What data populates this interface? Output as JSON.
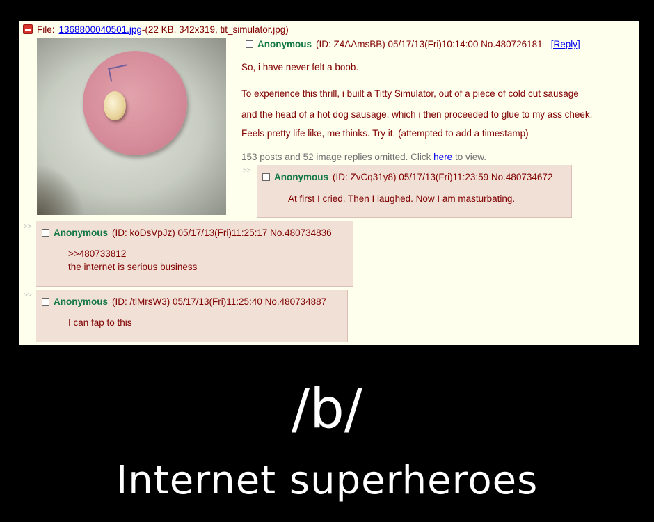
{
  "file": {
    "prefix": "File:",
    "name": "1368800040501.jpg",
    "details": "-(22 KB, 342x319, tit_simulator.jpg)"
  },
  "op": {
    "name": "Anonymous",
    "meta": "(ID: Z4AAmsBB) 05/17/13(Fri)10:14:00 No.480726181",
    "reply_label": "[Reply]",
    "lines": [
      "So, i have never felt a boob.",
      "To experience this thrill, i built a Titty Simulator, out of a piece of cold cut sausage",
      "and the head of a hot dog sausage, which i then proceeded to glue to  my ass cheek.",
      "Feels pretty life like, me thinks. Try it. (attempted to add a timestamp)"
    ],
    "omitted_text": "153 posts and 52 image replies omitted. Click",
    "omitted_link": "here",
    "omitted_suffix": "to view."
  },
  "replies": [
    {
      "arrows": ">>",
      "name": "Anonymous",
      "meta": "(ID: ZvCq31y8) 05/17/13(Fri)11:23:59 No.480734672",
      "quote": "",
      "message": "At first I cried. Then I laughed. Now I am masturbating."
    },
    {
      "arrows": ">>",
      "name": "Anonymous",
      "meta": "(ID: koDsVpJz) 05/17/13(Fri)11:25:17 No.480734836",
      "quote": ">>480733812",
      "message": "the internet is serious business"
    },
    {
      "arrows": ">>",
      "name": "Anonymous",
      "meta": "(ID: /tlMrsW3) 05/17/13(Fri)11:25:40 No.480734887",
      "quote": "",
      "message": "I can fap to this"
    }
  ],
  "caption": {
    "title": "/b/",
    "subtitle": "Internet superheroes"
  },
  "colors": {
    "background": "#000000",
    "board": "#ffffee",
    "reply": "#f0e0d6",
    "name": "#117743",
    "text": "#800000",
    "link": "#0000ee"
  },
  "icons": [
    "minus-icon",
    "checkbox-icon"
  ]
}
